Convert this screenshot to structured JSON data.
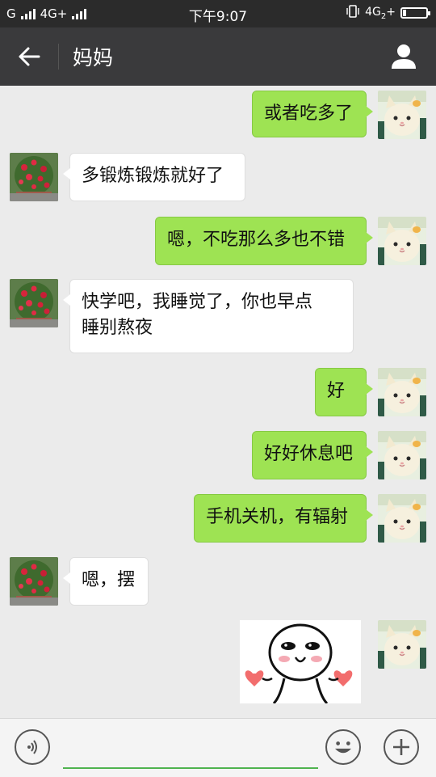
{
  "status_bar": {
    "carrier1": "G",
    "carrier2": "4G+",
    "time": "下午9:07",
    "right_network": "4G",
    "right_subscript": "2",
    "right_plus": "+"
  },
  "nav": {
    "title": "妈妈",
    "back_icon": "arrow-left-icon",
    "profile_icon": "person-icon"
  },
  "messages": [
    {
      "side": "out",
      "text": "或者吃多了"
    },
    {
      "side": "in",
      "text": "多锻炼锻炼就好了"
    },
    {
      "side": "out",
      "text": "嗯，不吃那么多也不错"
    },
    {
      "side": "in",
      "line1": "快学吧，我睡觉了，你也早点",
      "line2": "睡别熬夜"
    },
    {
      "side": "out",
      "text": "好"
    },
    {
      "side": "out",
      "text": "好好休息吧"
    },
    {
      "side": "out",
      "text": "手机关机，有辐射"
    },
    {
      "side": "in",
      "text": "嗯，摆"
    },
    {
      "side": "out",
      "type": "sticker",
      "sticker": "shy-face-with-hearts"
    }
  ],
  "input_bar": {
    "voice_icon": "voice-icon",
    "emoji_icon": "emoji-icon",
    "plus_icon": "plus-icon",
    "input_value": ""
  },
  "colors": {
    "outgoing_bubble": "#9ee353",
    "incoming_bubble": "#ffffff",
    "nav_bg": "#3a3a3c",
    "chat_bg": "#ebebeb"
  }
}
